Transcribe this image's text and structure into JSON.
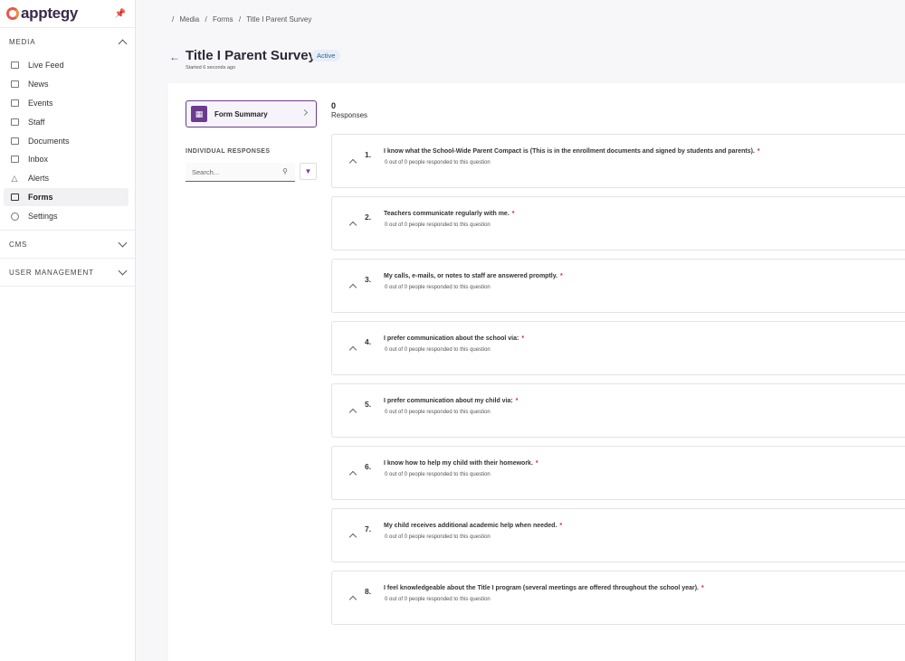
{
  "brand": {
    "logo_text": "apptegy"
  },
  "sidebar": {
    "media_label": "MEDIA",
    "items": [
      {
        "label": "Live Feed"
      },
      {
        "label": "News"
      },
      {
        "label": "Events"
      },
      {
        "label": "Staff"
      },
      {
        "label": "Documents"
      },
      {
        "label": "Inbox"
      },
      {
        "label": "Alerts"
      },
      {
        "label": "Forms"
      },
      {
        "label": "Settings"
      }
    ],
    "cms_label": "CMS",
    "user_mgmt_label": "USER MANAGEMENT"
  },
  "breadcrumb": [
    "/",
    "Media",
    "/",
    "Forms",
    "/",
    "Title I Parent Survey"
  ],
  "header": {
    "title": "Title I Parent Survey",
    "status": "Active",
    "started": "Started 6 seconds ago"
  },
  "summary": {
    "form_summary_label": "Form Summary",
    "individual_label": "INDIVIDUAL RESPONSES",
    "search_placeholder": "Search..."
  },
  "responses": {
    "count": "0",
    "label": "Responses"
  },
  "questions": [
    {
      "num": "1.",
      "text": "I know what the School-Wide Parent Compact is (This is in the enrollment documents and signed by students and parents).",
      "required": "*",
      "sub": "0 out of 0 people responded to this question"
    },
    {
      "num": "2.",
      "text": "Teachers communicate regularly with me.",
      "required": "*",
      "sub": "0 out of 0 people responded to this question"
    },
    {
      "num": "3.",
      "text": "My calls, e-mails, or notes to staff are answered promptly.",
      "required": "*",
      "sub": "0 out of 0 people responded to this question"
    },
    {
      "num": "4.",
      "text": "I prefer communication about the school via:",
      "required": "*",
      "sub": "0 out of 0 people responded to this question"
    },
    {
      "num": "5.",
      "text": "I prefer communication about my child via:",
      "required": "*",
      "sub": "0 out of 0 people responded to this question"
    },
    {
      "num": "6.",
      "text": "I know how to help my child with their homework.",
      "required": "*",
      "sub": "0 out of 0 people responded to this question"
    },
    {
      "num": "7.",
      "text": "My child receives additional academic help when needed.",
      "required": "*",
      "sub": "0 out of 0 people responded to this question"
    },
    {
      "num": "8.",
      "text": "I feel knowledgeable about the Title I program (several meetings are offered throughout the school year).",
      "required": "*",
      "sub": "0 out of 0 people responded to this question"
    }
  ],
  "icons": {
    "nav": [
      "live-feed-icon",
      "news-icon",
      "events-icon",
      "staff-icon",
      "documents-icon",
      "inbox-icon",
      "alerts-icon",
      "forms-icon",
      "settings-icon"
    ]
  },
  "colors": {
    "accent": "#6b3c8e",
    "brand_orange": "#e8594a",
    "required": "#dd2233",
    "badge_bg": "#e7eef8"
  }
}
